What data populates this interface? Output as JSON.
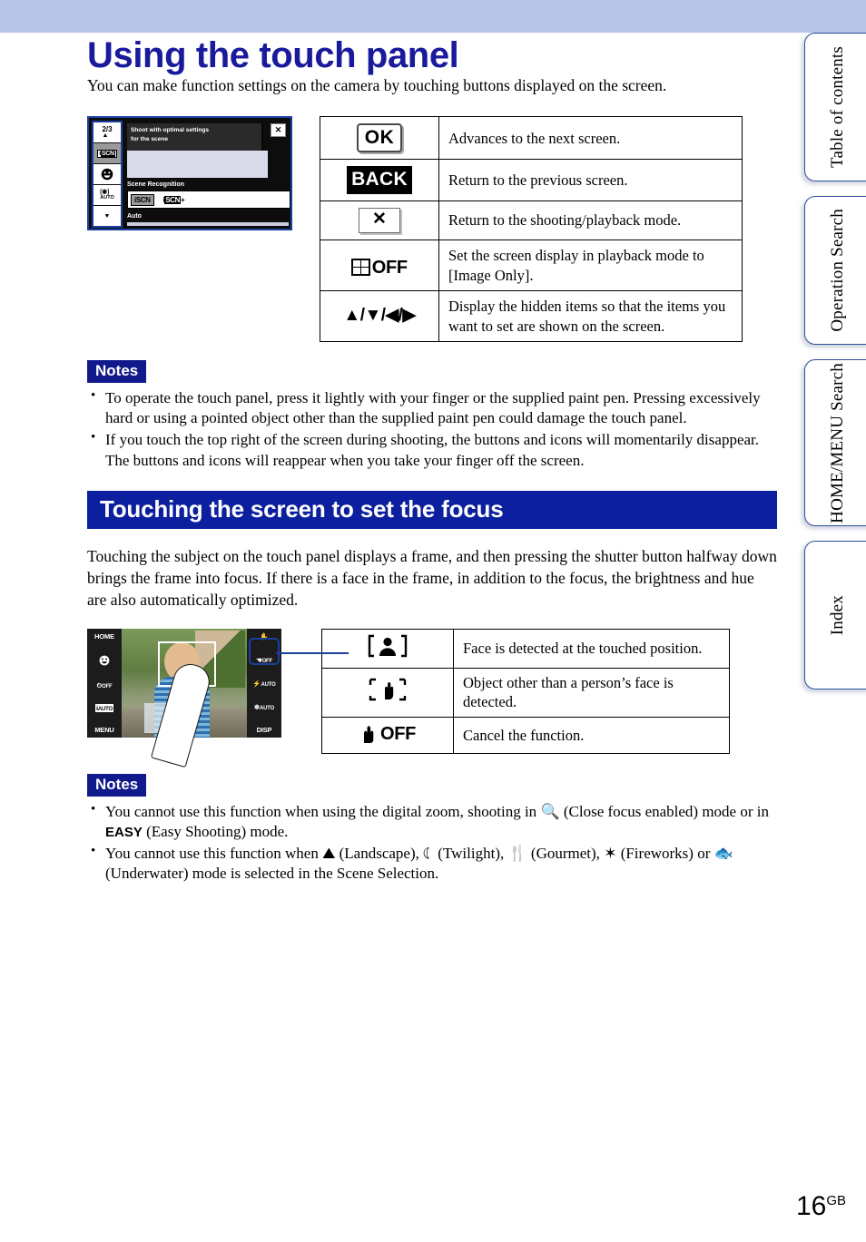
{
  "page": {
    "title": "Using the touch panel",
    "intro": "You can make function settings on the camera by touching buttons displayed on the screen.",
    "page_number": "16",
    "page_number_suffix": "GB"
  },
  "colors": {
    "title_blue": "#1a1a9c",
    "section_blue": "#0c1f9e",
    "notes_badge_blue": "#111a8c",
    "top_band": "#bac6e8",
    "tab_border": "#2d4f9e"
  },
  "side_tabs": [
    {
      "label": "Table of contents",
      "name": "tab-table-of-contents"
    },
    {
      "label": "Operation Search",
      "name": "tab-operation-search"
    },
    {
      "label": "HOME/MENU Search",
      "name": "tab-home-menu-search"
    },
    {
      "label": "Index",
      "name": "tab-index"
    }
  ],
  "illustration_menu": {
    "sidebar": [
      {
        "text": "2/3",
        "sub": "▲",
        "selected": false
      },
      {
        "text": "iSCN",
        "selected": true
      },
      {
        "text": "smile",
        "selected": false
      },
      {
        "text": "[●] AUTO",
        "selected": false
      },
      {
        "text": "▼",
        "selected": false
      }
    ],
    "tooltip_line1": "Shoot with optimal settings",
    "tooltip_line2": "for the scene",
    "close_label": "✕",
    "section_label": "Scene Recognition",
    "option_a": "iSCN",
    "option_b": "iSCN+",
    "bottom_label": "Auto"
  },
  "table_buttons": {
    "rows": [
      {
        "icon": "ok-icon",
        "icon_label": "OK",
        "description": "Advances to the next screen."
      },
      {
        "icon": "back-icon",
        "icon_label": "BACK",
        "description": "Return to the previous screen."
      },
      {
        "icon": "close-icon",
        "icon_label": "✕",
        "description": "Return to the shooting/playback mode."
      },
      {
        "icon": "display-off-icon",
        "icon_label": "OFF",
        "description": "Set the screen display in playback mode to [Image Only]."
      },
      {
        "icon": "direction-arrows-icon",
        "icon_label": "▲/▼/◀/▶",
        "description": "Display the hidden items so that the items you want to set are shown on the screen."
      }
    ]
  },
  "notes_1": {
    "badge": "Notes",
    "items": [
      "To operate the touch panel, press it lightly with your finger or the supplied paint pen. Pressing excessively hard or using a pointed object other than the supplied paint pen could damage the touch panel.",
      "If you touch the top right of the screen during shooting, the buttons and icons will momentarily disappear. The buttons and icons will reappear when you take your finger off the screen."
    ]
  },
  "section": {
    "heading": "Touching the screen to set the focus",
    "body": "Touching the subject on the touch panel displays a frame, and then pressing the shutter button halfway down brings the frame into focus. If there is a face in the frame, in addition to the focus, the brightness and hue are also automatically optimized."
  },
  "illustration_photo": {
    "left_items": [
      "HOME",
      "smile-icon",
      "self-timer-OFF",
      "iSCN-AUTO",
      "MENU"
    ],
    "right_items": [
      "touch-af-icon",
      "touch-af-OFF",
      "flash-AUTO",
      "macro-AUTO",
      "DISP"
    ],
    "left_labels": {
      "home": "HOME",
      "menu": "MENU"
    },
    "right_labels": {
      "off": "OFF",
      "flash": "AUTO",
      "macro": "AUTO",
      "disp": "DISP"
    }
  },
  "table_focus": {
    "rows": [
      {
        "icon": "face-detect-icon",
        "description": "Face is detected at the touched position."
      },
      {
        "icon": "object-detect-icon",
        "description": "Object other than a person’s face is detected."
      },
      {
        "icon": "touch-af-off-icon",
        "icon_label": "OFF",
        "description": "Cancel the function."
      }
    ]
  },
  "notes_2": {
    "badge": "Notes",
    "items": [
      {
        "parts": [
          {
            "type": "text",
            "value": "You cannot use this function when using the digital zoom, shooting in "
          },
          {
            "type": "icon",
            "name": "close-focus-icon",
            "value": "❂ⓠ"
          },
          {
            "type": "text",
            "value": " (Close focus enabled) mode or in "
          },
          {
            "type": "bold",
            "value": "EASY"
          },
          {
            "type": "text",
            "value": " (Easy Shooting) mode."
          }
        ],
        "plain": "You cannot use this function when using the digital zoom, shooting in (Close focus enabled) mode or in EASY (Easy Shooting) mode."
      },
      {
        "parts": [
          {
            "type": "text",
            "value": "You cannot use this function when "
          },
          {
            "type": "icon",
            "name": "landscape-icon",
            "value": "⛰"
          },
          {
            "type": "text",
            "value": " (Landscape), "
          },
          {
            "type": "icon",
            "name": "twilight-icon",
            "value": "☽"
          },
          {
            "type": "text",
            "value": " (Twilight), "
          },
          {
            "type": "icon",
            "name": "gourmet-icon",
            "value": "ἷ4"
          },
          {
            "type": "text",
            "value": " (Gourmet), "
          },
          {
            "type": "icon",
            "name": "fireworks-icon",
            "value": "✹"
          },
          {
            "type": "text",
            "value": " (Fireworks) or "
          },
          {
            "type": "icon",
            "name": "underwater-icon",
            "value": "ὁf"
          },
          {
            "type": "text",
            "value": " (Underwater) mode is selected in the Scene Selection."
          }
        ],
        "plain": "You cannot use this function when (Landscape), (Twilight), (Gourmet), (Fireworks) or (Underwater) mode is selected in the Scene Selection."
      }
    ],
    "text_landscape": " (Landscape), ",
    "text_twilight": " (Twilight), ",
    "text_gourmet": " (Gourmet), ",
    "text_fireworks": " (Fireworks) or ",
    "text_underwater": " (Underwater) mode is selected in the Scene Selection.",
    "text_lead1": "You cannot use this function when using the digital zoom, shooting in ",
    "text_mid1": " (Close focus enabled) mode or in ",
    "bold_easy": "EASY",
    "text_end1": " (Easy Shooting) mode.",
    "text_lead2": "You cannot use this function when "
  }
}
